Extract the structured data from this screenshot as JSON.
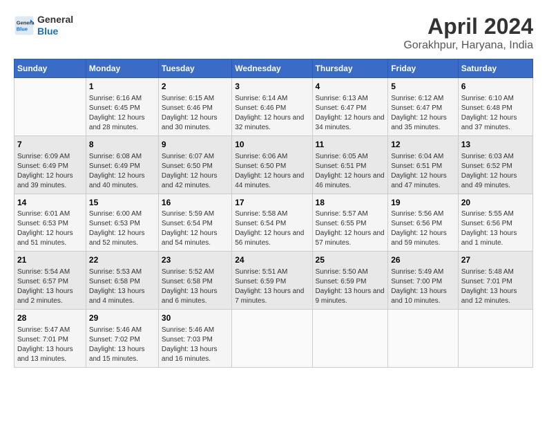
{
  "header": {
    "logo_line1": "General",
    "logo_line2": "Blue",
    "title": "April 2024",
    "subtitle": "Gorakhpur, Haryana, India"
  },
  "calendar": {
    "days_of_week": [
      "Sunday",
      "Monday",
      "Tuesday",
      "Wednesday",
      "Thursday",
      "Friday",
      "Saturday"
    ],
    "weeks": [
      [
        {
          "day": "",
          "sunrise": "",
          "sunset": "",
          "daylight": ""
        },
        {
          "day": "1",
          "sunrise": "Sunrise: 6:16 AM",
          "sunset": "Sunset: 6:45 PM",
          "daylight": "Daylight: 12 hours and 28 minutes."
        },
        {
          "day": "2",
          "sunrise": "Sunrise: 6:15 AM",
          "sunset": "Sunset: 6:46 PM",
          "daylight": "Daylight: 12 hours and 30 minutes."
        },
        {
          "day": "3",
          "sunrise": "Sunrise: 6:14 AM",
          "sunset": "Sunset: 6:46 PM",
          "daylight": "Daylight: 12 hours and 32 minutes."
        },
        {
          "day": "4",
          "sunrise": "Sunrise: 6:13 AM",
          "sunset": "Sunset: 6:47 PM",
          "daylight": "Daylight: 12 hours and 34 minutes."
        },
        {
          "day": "5",
          "sunrise": "Sunrise: 6:12 AM",
          "sunset": "Sunset: 6:47 PM",
          "daylight": "Daylight: 12 hours and 35 minutes."
        },
        {
          "day": "6",
          "sunrise": "Sunrise: 6:10 AM",
          "sunset": "Sunset: 6:48 PM",
          "daylight": "Daylight: 12 hours and 37 minutes."
        }
      ],
      [
        {
          "day": "7",
          "sunrise": "Sunrise: 6:09 AM",
          "sunset": "Sunset: 6:49 PM",
          "daylight": "Daylight: 12 hours and 39 minutes."
        },
        {
          "day": "8",
          "sunrise": "Sunrise: 6:08 AM",
          "sunset": "Sunset: 6:49 PM",
          "daylight": "Daylight: 12 hours and 40 minutes."
        },
        {
          "day": "9",
          "sunrise": "Sunrise: 6:07 AM",
          "sunset": "Sunset: 6:50 PM",
          "daylight": "Daylight: 12 hours and 42 minutes."
        },
        {
          "day": "10",
          "sunrise": "Sunrise: 6:06 AM",
          "sunset": "Sunset: 6:50 PM",
          "daylight": "Daylight: 12 hours and 44 minutes."
        },
        {
          "day": "11",
          "sunrise": "Sunrise: 6:05 AM",
          "sunset": "Sunset: 6:51 PM",
          "daylight": "Daylight: 12 hours and 46 minutes."
        },
        {
          "day": "12",
          "sunrise": "Sunrise: 6:04 AM",
          "sunset": "Sunset: 6:51 PM",
          "daylight": "Daylight: 12 hours and 47 minutes."
        },
        {
          "day": "13",
          "sunrise": "Sunrise: 6:03 AM",
          "sunset": "Sunset: 6:52 PM",
          "daylight": "Daylight: 12 hours and 49 minutes."
        }
      ],
      [
        {
          "day": "14",
          "sunrise": "Sunrise: 6:01 AM",
          "sunset": "Sunset: 6:53 PM",
          "daylight": "Daylight: 12 hours and 51 minutes."
        },
        {
          "day": "15",
          "sunrise": "Sunrise: 6:00 AM",
          "sunset": "Sunset: 6:53 PM",
          "daylight": "Daylight: 12 hours and 52 minutes."
        },
        {
          "day": "16",
          "sunrise": "Sunrise: 5:59 AM",
          "sunset": "Sunset: 6:54 PM",
          "daylight": "Daylight: 12 hours and 54 minutes."
        },
        {
          "day": "17",
          "sunrise": "Sunrise: 5:58 AM",
          "sunset": "Sunset: 6:54 PM",
          "daylight": "Daylight: 12 hours and 56 minutes."
        },
        {
          "day": "18",
          "sunrise": "Sunrise: 5:57 AM",
          "sunset": "Sunset: 6:55 PM",
          "daylight": "Daylight: 12 hours and 57 minutes."
        },
        {
          "day": "19",
          "sunrise": "Sunrise: 5:56 AM",
          "sunset": "Sunset: 6:56 PM",
          "daylight": "Daylight: 12 hours and 59 minutes."
        },
        {
          "day": "20",
          "sunrise": "Sunrise: 5:55 AM",
          "sunset": "Sunset: 6:56 PM",
          "daylight": "Daylight: 13 hours and 1 minute."
        }
      ],
      [
        {
          "day": "21",
          "sunrise": "Sunrise: 5:54 AM",
          "sunset": "Sunset: 6:57 PM",
          "daylight": "Daylight: 13 hours and 2 minutes."
        },
        {
          "day": "22",
          "sunrise": "Sunrise: 5:53 AM",
          "sunset": "Sunset: 6:58 PM",
          "daylight": "Daylight: 13 hours and 4 minutes."
        },
        {
          "day": "23",
          "sunrise": "Sunrise: 5:52 AM",
          "sunset": "Sunset: 6:58 PM",
          "daylight": "Daylight: 13 hours and 6 minutes."
        },
        {
          "day": "24",
          "sunrise": "Sunrise: 5:51 AM",
          "sunset": "Sunset: 6:59 PM",
          "daylight": "Daylight: 13 hours and 7 minutes."
        },
        {
          "day": "25",
          "sunrise": "Sunrise: 5:50 AM",
          "sunset": "Sunset: 6:59 PM",
          "daylight": "Daylight: 13 hours and 9 minutes."
        },
        {
          "day": "26",
          "sunrise": "Sunrise: 5:49 AM",
          "sunset": "Sunset: 7:00 PM",
          "daylight": "Daylight: 13 hours and 10 minutes."
        },
        {
          "day": "27",
          "sunrise": "Sunrise: 5:48 AM",
          "sunset": "Sunset: 7:01 PM",
          "daylight": "Daylight: 13 hours and 12 minutes."
        }
      ],
      [
        {
          "day": "28",
          "sunrise": "Sunrise: 5:47 AM",
          "sunset": "Sunset: 7:01 PM",
          "daylight": "Daylight: 13 hours and 13 minutes."
        },
        {
          "day": "29",
          "sunrise": "Sunrise: 5:46 AM",
          "sunset": "Sunset: 7:02 PM",
          "daylight": "Daylight: 13 hours and 15 minutes."
        },
        {
          "day": "30",
          "sunrise": "Sunrise: 5:46 AM",
          "sunset": "Sunset: 7:03 PM",
          "daylight": "Daylight: 13 hours and 16 minutes."
        },
        {
          "day": "",
          "sunrise": "",
          "sunset": "",
          "daylight": ""
        },
        {
          "day": "",
          "sunrise": "",
          "sunset": "",
          "daylight": ""
        },
        {
          "day": "",
          "sunrise": "",
          "sunset": "",
          "daylight": ""
        },
        {
          "day": "",
          "sunrise": "",
          "sunset": "",
          "daylight": ""
        }
      ]
    ]
  }
}
